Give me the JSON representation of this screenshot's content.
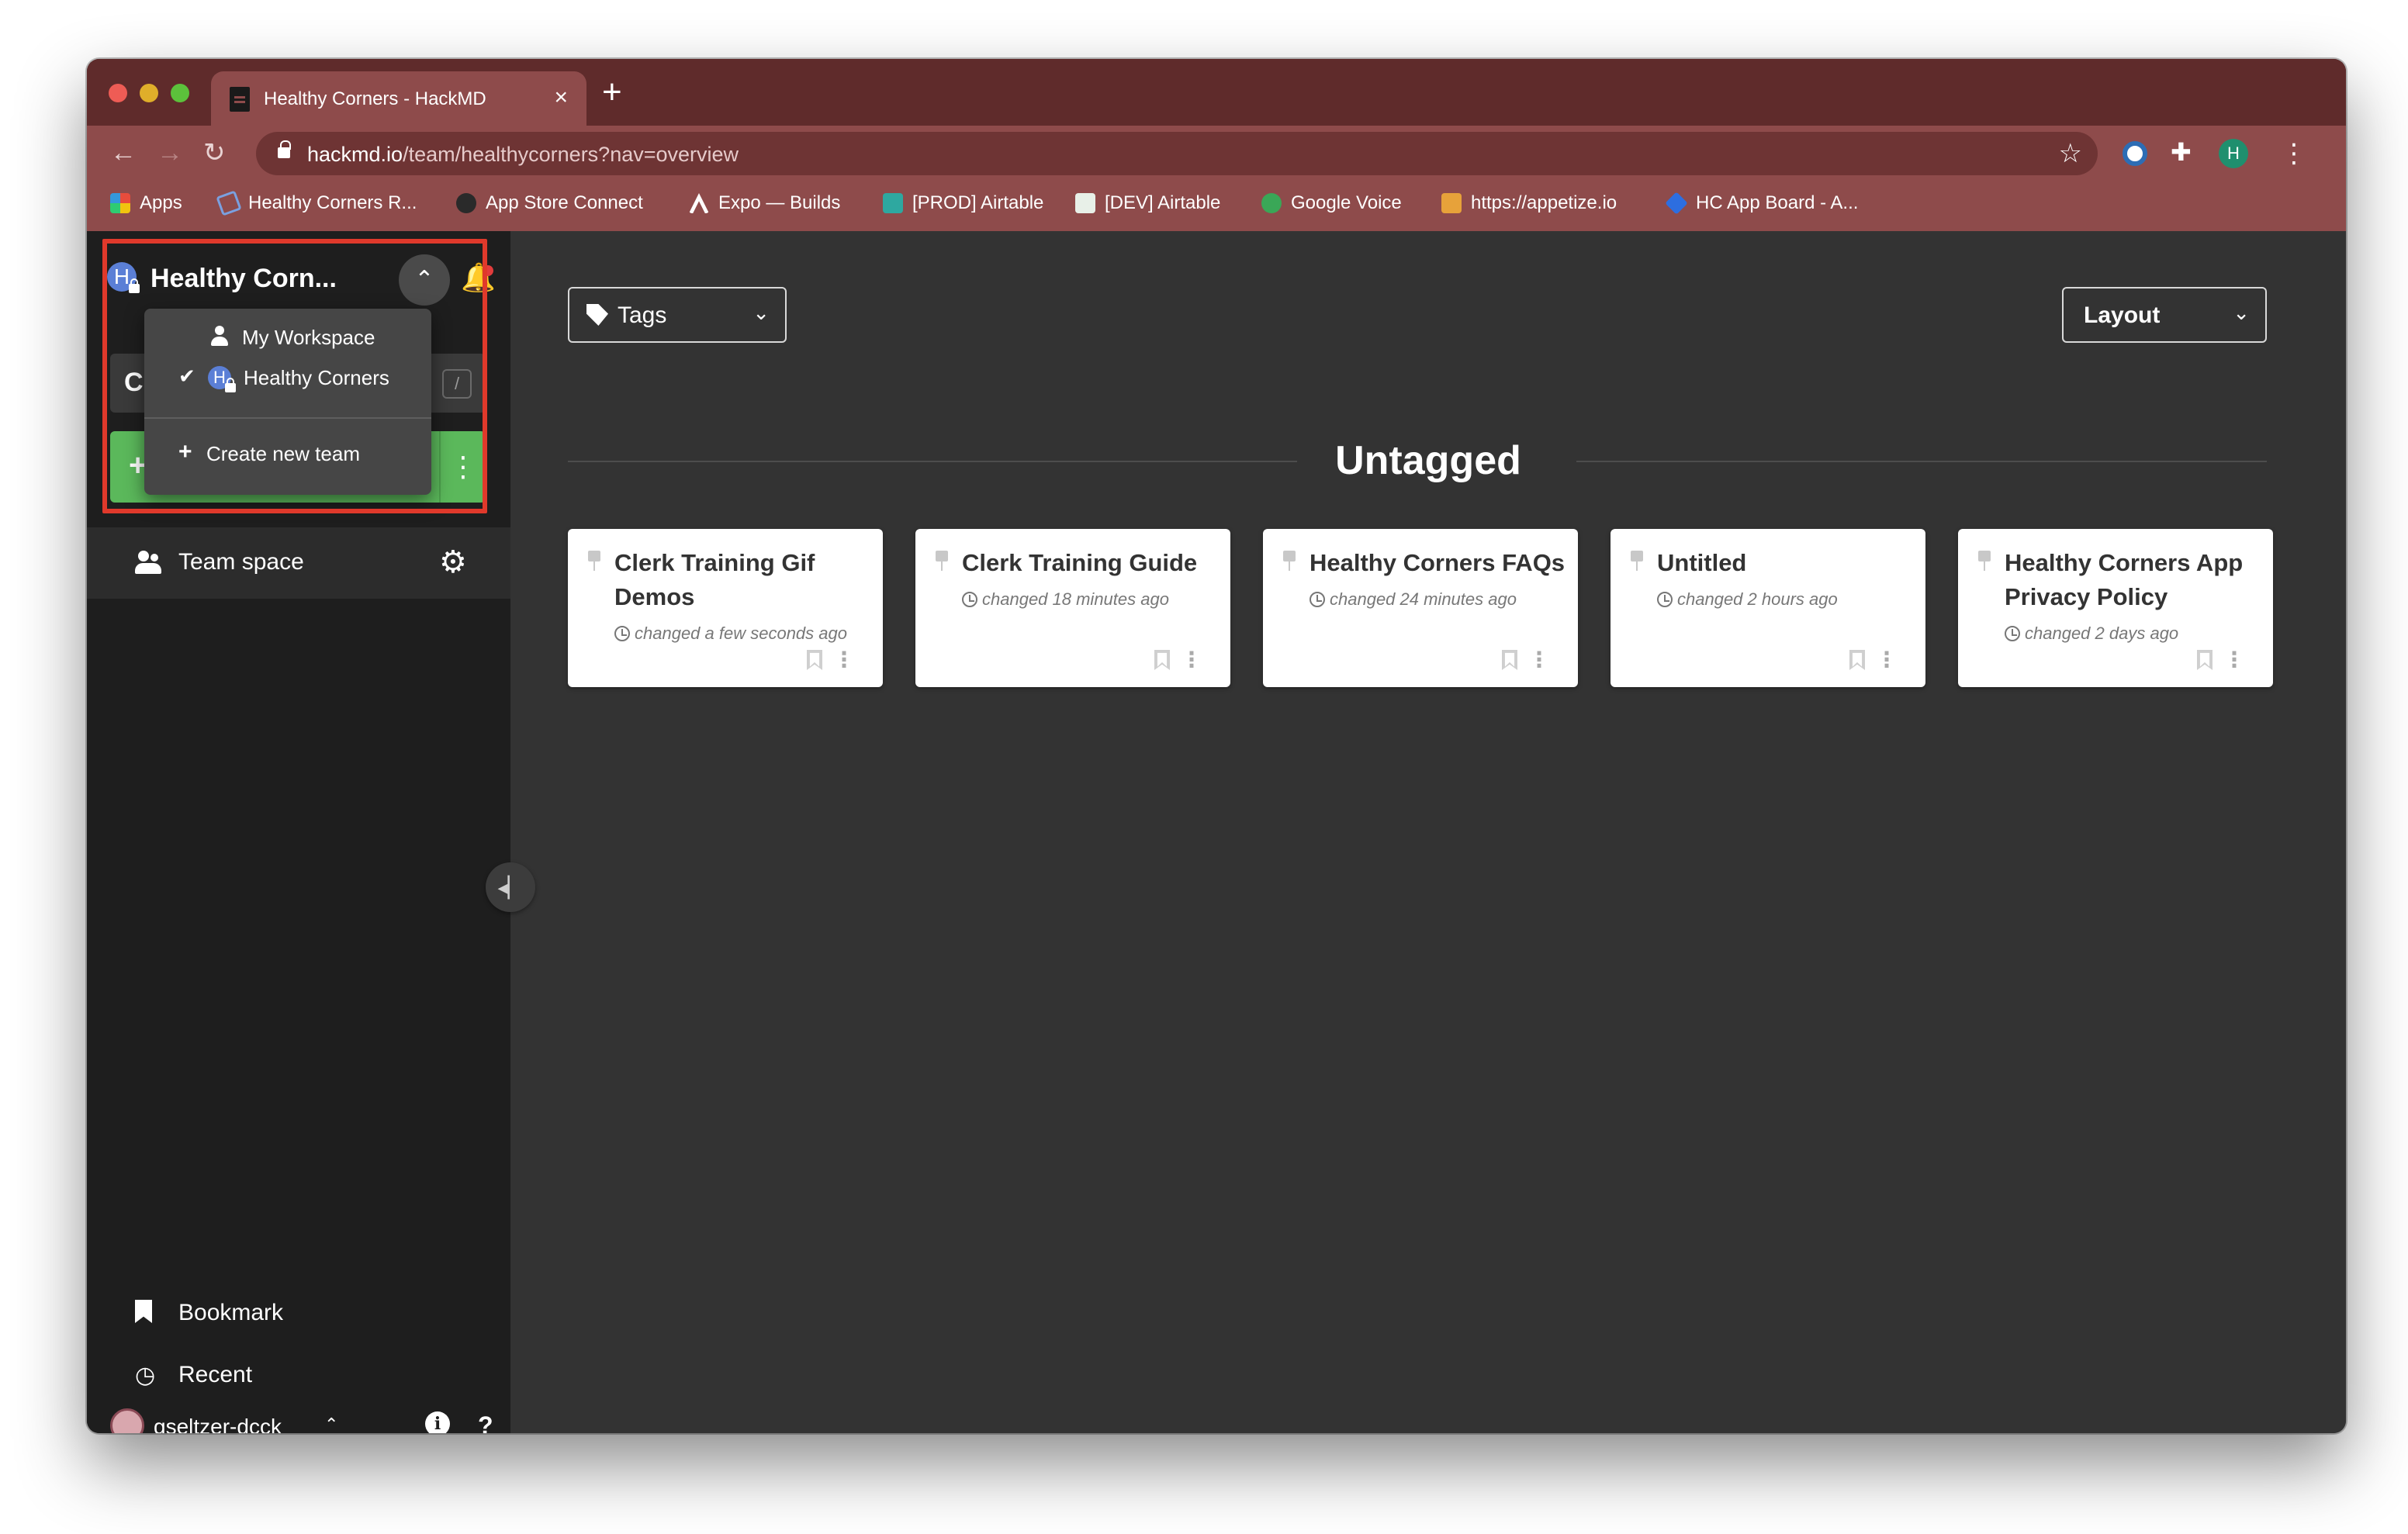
{
  "browser": {
    "tab_title": "Healthy Corners - HackMD",
    "tab_close": "×",
    "new_tab": "+",
    "url_host": "hackmd.io",
    "url_path": "/team/healthycorners?nav=overview",
    "profile_initial": "H",
    "nav": {
      "back": "←",
      "forward": "→",
      "reload": "↻",
      "star": "☆",
      "menu": "⋮",
      "extensions": "✚"
    }
  },
  "bookmarks": [
    {
      "label": "Apps",
      "icon": "apps-grid-icon",
      "color": "#e0a030"
    },
    {
      "label": "Healthy Corners R...",
      "icon": "document-icon",
      "color": "#7aa0e0"
    },
    {
      "label": "App Store Connect",
      "icon": "apple-icon",
      "color": "#2a2a2a"
    },
    {
      "label": "Expo — Builds",
      "icon": "expo-icon",
      "color": "#ffffff"
    },
    {
      "label": "[PROD] Airtable",
      "icon": "shield-icon",
      "color": "#2ea8a0"
    },
    {
      "label": "[DEV] Airtable",
      "icon": "lightning-icon",
      "color": "#e8f0e8"
    },
    {
      "label": "Google Voice",
      "icon": "google-voice-icon",
      "color": "#3aa757"
    },
    {
      "label": "https://appetize.io",
      "icon": "cube-icon",
      "color": "#e7a23a"
    },
    {
      "label": "HC App Board - A...",
      "icon": "jira-icon",
      "color": "#2d6ee0"
    }
  ],
  "sidebar": {
    "team_initial": "H",
    "team_name": "Healthy Corn...",
    "collapse_glyph": "⌃",
    "bell_glyph": "🔔",
    "search_glyph": "C",
    "search_shortcut": "/",
    "new_note_glyph": "+",
    "new_note_more": "⋮",
    "team_dropdown": {
      "items": [
        {
          "label": "My Workspace",
          "selected": false
        },
        {
          "label": "Healthy Corners",
          "selected": true,
          "initial": "H",
          "check": "✔"
        }
      ],
      "create": {
        "glyph": "+",
        "label": "Create new team"
      }
    },
    "team_space": {
      "label": "Team space",
      "gear": "⚙"
    },
    "bookmark_label": "Bookmark",
    "recent_label": "Recent",
    "recent_glyph": "◷",
    "user": {
      "name": "gseltzer-dcck",
      "caret": "⌃",
      "info": "i",
      "help": "?"
    },
    "toggle_glyph": "◂▏"
  },
  "main": {
    "tags_label": "Tags",
    "layout_label": "Layout",
    "chevron": "⌄",
    "section_title": "Untagged",
    "more_glyph": "⋮",
    "cards": [
      {
        "title": "Clerk Training Gif Demos",
        "changed": "changed a few seconds ago"
      },
      {
        "title": "Clerk Training Guide",
        "changed": "changed 18 minutes ago"
      },
      {
        "title": "Healthy Corners FAQs",
        "changed": "changed 24 minutes ago"
      },
      {
        "title": "Untitled",
        "changed": "changed 2 hours ago"
      },
      {
        "title": "Healthy Corners App Privacy Policy",
        "changed": "changed 2 days ago"
      }
    ]
  },
  "colors": {
    "tab_strip": "#5f2b2b",
    "toolbar": "#8e4b4b",
    "sidebar": "#1e1e1e",
    "main_bg": "#333333",
    "new_note_green": "#5bb85b",
    "highlight_red": "#e0392b",
    "team_avatar": "#5b7fd6"
  }
}
